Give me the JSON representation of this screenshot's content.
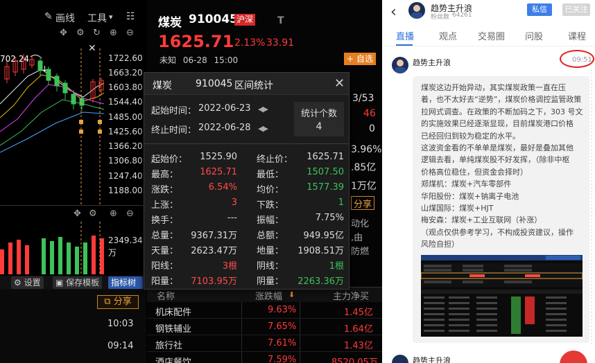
{
  "chart_toolbar": {
    "draw_line": "画线",
    "tools": "工具",
    "tools_arrow": "▾"
  },
  "chart_controls": {
    "move": "✥",
    "gear": "⚙",
    "refresh": "↻",
    "zoom_in": "⊕",
    "zoom_out": "⊖",
    "close": "✕"
  },
  "chart_annotation": "702.24",
  "price_labels": [
    "1722.60",
    "1663.20",
    "1603.80",
    "1544.40",
    "1485.00",
    "1425.60",
    "1366.20",
    "1306.80",
    "1247.40",
    "1188.00"
  ],
  "vol_controls": {
    "move": "✥",
    "gear": "⚙",
    "zoom_in": "⊕",
    "zoom_out": "⊖",
    "close": "✕"
  },
  "vol_labels": {
    "value": "2349.34",
    "unit": "万"
  },
  "bottom_tools": {
    "settings": "设置",
    "save_template": "保存模板",
    "indicator_tree": "指标树"
  },
  "left_share": "分享",
  "times": [
    "10:03",
    "09:14"
  ],
  "stock": {
    "name": "煤炭",
    "code": "910045",
    "market": "沪深",
    "t_label": "T",
    "price": "1625.71",
    "pct": "2.13%",
    "change": "33.91",
    "status": "未知",
    "date": "06-28",
    "time": "15:00",
    "add_fav": "自选"
  },
  "side_values": [
    "3/53",
    "46",
    "0",
    "3.96%",
    ".85亿",
    "1万亿",
    "分享",
    "动化",
    ",由",
    "防燃"
  ],
  "list": {
    "headers": [
      "名称",
      "涨跌幅",
      "主力净买"
    ],
    "sort_arrow": "⬇",
    "rows": [
      {
        "name": "机床配件",
        "pct": "9.63%",
        "net": "1.45亿"
      },
      {
        "name": "钢铁辅业",
        "pct": "7.65%",
        "net": "1.64亿"
      },
      {
        "name": "旅行社",
        "pct": "7.61%",
        "net": "1.43亿"
      },
      {
        "name": "酒店餐饮",
        "pct": "7.59%",
        "net": "8520.05万"
      }
    ]
  },
  "modal": {
    "name": "煤炭",
    "code": "910045",
    "title": "区间统计",
    "close": "✕",
    "start_label": "起始时间：",
    "start_value": "2022-06-23",
    "end_label": "终止时间：",
    "end_value": "2022-06-28",
    "arrows": "◀▶",
    "count_label": "统计个数",
    "count_value": "4",
    "stats": [
      {
        "l_label": "起始价：",
        "l_value": "1525.90",
        "l_color": "white",
        "r_label": "终止价：",
        "r_value": "1625.71",
        "r_color": "white"
      },
      {
        "l_label": "最高：",
        "l_value": "1625.71",
        "l_color": "red",
        "r_label": "最低：",
        "r_value": "1507.50",
        "r_color": "green"
      },
      {
        "l_label": "涨跌：",
        "l_value": "6.54%",
        "l_color": "red",
        "r_label": "均价：",
        "r_value": "1577.39",
        "r_color": "green"
      },
      {
        "l_label": "上涨：",
        "l_value": "3",
        "l_color": "red",
        "r_label": "下跌：",
        "r_value": "1",
        "r_color": "green"
      },
      {
        "l_label": "换手：",
        "l_value": "---",
        "l_color": "white",
        "r_label": "振幅：",
        "r_value": "7.75%",
        "r_color": "white"
      },
      {
        "l_label": "总量：",
        "l_value": "9367.31万",
        "l_color": "white",
        "r_label": "总额：",
        "r_value": "949.95亿",
        "r_color": "white"
      },
      {
        "l_label": "天量：",
        "l_value": "2623.47万",
        "l_color": "white",
        "r_label": "地量：",
        "r_value": "1908.51万",
        "r_color": "white"
      },
      {
        "l_label": "阳线：",
        "l_value": "3根",
        "l_color": "red",
        "r_label": "阴线：",
        "r_value": "1根",
        "r_color": "green"
      },
      {
        "l_label": "阳量：",
        "l_value": "7103.95万",
        "l_color": "red",
        "r_label": "阴量：",
        "r_value": "2263.36万",
        "r_color": "green"
      }
    ]
  },
  "social": {
    "back": "‹",
    "author": "趋势主升浪",
    "fans_label": "粉丝数",
    "fans_count": "64261",
    "pm_button": "私信",
    "follow_button": "已关注",
    "tabs": [
      "直播",
      "观点",
      "交易圈",
      "问股",
      "课程"
    ],
    "post_author": "趋势主升浪",
    "post_time": "09:51",
    "post_lines": [
      "煤炭这边开始异动，其实煤炭政策一直在压",
      "着，也不太好去“逆势”，煤炭价格调控监管政策",
      "拉网式调查。在政策的不断加码之下，303 号文",
      "的实施效果已经逐渐显现，目前煤炭港口价格",
      "已经回归到较为稳定的水平。",
      "这波资金看的不单单是煤炭，最好是叠加其他",
      "逻辑去看，单纯煤炭股不好发挥，（除非中枢",
      "价格高位稳住，但资金会择时）",
      "郑煤机：煤炭+汽车零部件",
      "华阳股份：煤炭+钠离子电池",
      "山煤国际：煤炭+HJT",
      "梅安森：煤炭+工业互联网（补涨）",
      "（观点仅供参考学习，不构成投资建议，操作",
      "风险自担）"
    ],
    "next_author": "趋势主升浪"
  }
}
